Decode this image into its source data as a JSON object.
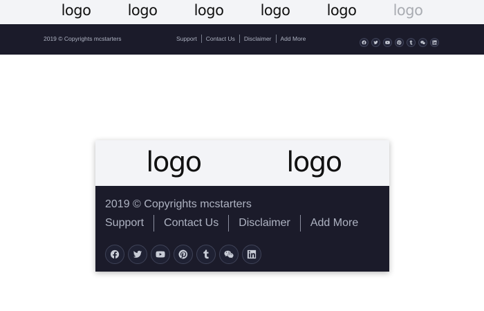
{
  "top_logos": [
    {
      "text": "logo"
    },
    {
      "text": "logo"
    },
    {
      "text": "logo"
    },
    {
      "text": "logo"
    },
    {
      "text": "logo"
    },
    {
      "text": "logo"
    }
  ],
  "top_footer": {
    "copyright": "2019 © Copyrights mcstarters",
    "links": [
      "Support",
      "Contact Us",
      "Disclaimer",
      "Add More"
    ],
    "social_icons": [
      "facebook-icon",
      "twitter-icon",
      "youtube-icon",
      "pinterest-icon",
      "tumblr-icon",
      "wechat-icon",
      "linkedin-icon"
    ]
  },
  "card": {
    "logos": [
      {
        "text": "logo"
      },
      {
        "text": "logo"
      }
    ],
    "copyright": "2019 © Copyrights mcstarters",
    "links": [
      "Support",
      "Contact Us",
      "Disclaimer",
      "Add More"
    ],
    "social_icons": [
      "facebook-icon",
      "twitter-icon",
      "youtube-icon",
      "pinterest-icon",
      "tumblr-icon",
      "wechat-icon",
      "linkedin-icon"
    ]
  },
  "colors": {
    "footer_bg": "#1b1b2a",
    "footer_text": "#aeb3c2",
    "logo_strip_bg": "#f3f4f7",
    "logo_faded": "#a9acb2"
  }
}
